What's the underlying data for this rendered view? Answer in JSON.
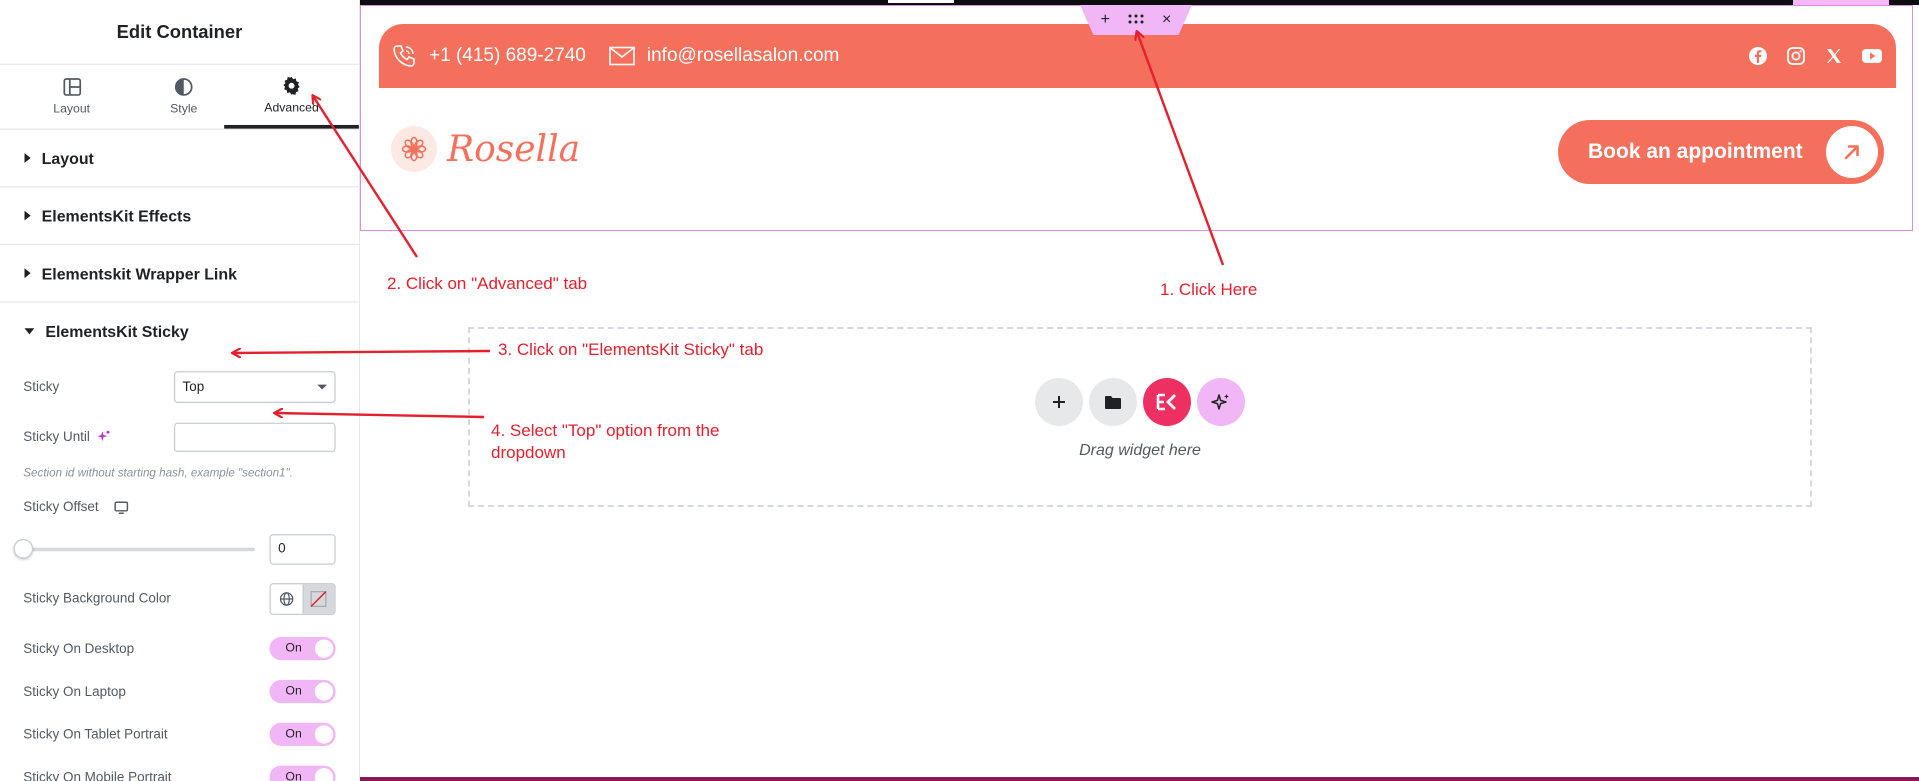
{
  "panel": {
    "title": "Edit Container",
    "tabs": [
      {
        "label": "Layout",
        "icon": "layout-icon"
      },
      {
        "label": "Style",
        "icon": "style-icon"
      },
      {
        "label": "Advanced",
        "icon": "gear-icon",
        "active": true
      }
    ],
    "sections": [
      "Layout",
      "ElementsKit Effects",
      "Elementskit Wrapper Link",
      "ElementsKit Sticky"
    ],
    "sticky": {
      "sticky_label": "Sticky",
      "sticky_value": "Top",
      "sticky_until_label": "Sticky Until",
      "sticky_until_value": "",
      "sticky_until_hint": "Section id without starting hash, example \"section1\".",
      "sticky_offset_label": "Sticky Offset",
      "sticky_offset_value": "0",
      "bg_color_label": "Sticky Background Color",
      "toggles": [
        {
          "label": "Sticky On Desktop",
          "state": "On"
        },
        {
          "label": "Sticky On Laptop",
          "state": "On"
        },
        {
          "label": "Sticky On Tablet Portrait",
          "state": "On"
        },
        {
          "label": "Sticky On Mobile Portrait",
          "state": "On"
        }
      ]
    }
  },
  "canvas": {
    "phone": "+1 (415) 689-2740",
    "email": "info@rosellasalon.com",
    "socials": [
      "facebook-icon",
      "instagram-icon",
      "x-icon",
      "youtube-icon"
    ],
    "logo_text": "Rosella",
    "cta_label": "Book an appointment",
    "dropzone_text": "Drag widget here"
  },
  "annotations": {
    "step1": "1. Click Here",
    "step2": "2. Click on \"Advanced\" tab",
    "step3": "3. Click on \"ElementsKit Sticky\" tab",
    "step4_line1": "4. Select \"Top\" option from the",
    "step4_line2": "dropdown"
  },
  "colors": {
    "brand": "#f5705c",
    "editor_accent": "#f1b6f5",
    "annotation": "#e4202d",
    "ek_button": "#ee2f62"
  }
}
